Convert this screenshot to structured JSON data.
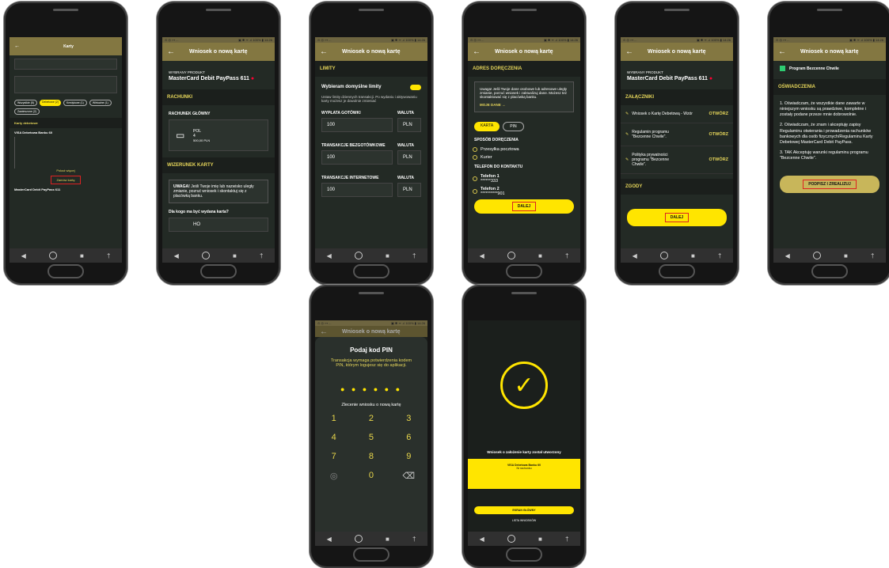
{
  "status": {
    "left": "⊙ ◎ ⊶ ...",
    "right": "▣ ✱ ᯤ .ıl 100% ▮ 14:26"
  },
  "p1": {
    "title": "Karty",
    "rows": [
      "Wszystkie (5)",
      "Debetowe (2)",
      "Kredytowe (1)",
      "Wirtualne (1)",
      "Zawieszone (2)"
    ],
    "section": "Karty debetowe",
    "card1": "VISA Debetowa Banku 60",
    "card2": "MasterCard Debit PayPass 611",
    "link": "Pokaż więcej",
    "btn": "Zamów kartę"
  },
  "p2": {
    "title": "Wniosek o nową kartę",
    "prodlbl": "WYBRANY PRODUKT",
    "prod": "MasterCard Debit PayPass 611",
    "sec1": "RACHUNKI",
    "acclbl": "RACHUNEK GŁÓWNY",
    "accname": "POL",
    "acc": "4",
    "bal": "500,00 PLN",
    "sec2": "WIZERUNEK KARTY",
    "warnb": "UWAGA!",
    "warn": " Jeśli Twoje imię lub nazwisko uległy zmianie, pozruć wniosek i skontaktuj się z placówką banku.",
    "q": "Dla kogo ma być wydana karta?",
    "who": "HO"
  },
  "p3": {
    "title": "Wniosek o nową kartę",
    "sec": "LIMITY",
    "def": "Wybieram domyślne limity",
    "info": "Ustaw limity dziennych transakcji. Po wydaniu i aktywowaniu karty możesz je dowolnie zmieniać",
    "l1": "WYPŁATA GOTÓWKI",
    "l2": "TRANSAKCJE BEZGOTÓWKOWE",
    "l3": "TRANSAKCJE INTERNETOWE",
    "wal": "WALUTA",
    "val": "100",
    "cur": "PLN"
  },
  "p4": {
    "title": "Wniosek o nową kartę",
    "sec": "ADRES DORĘCZENIA",
    "note": "Uwaga! Jeśli Twoje dane osobowe lub adresowe uległy zmianie, porzuć wniosek i zaktualizuj dane. Możesz też skontaktować się z placówką banku.",
    "myd": "MOJE DANE  →",
    "t1": "KARTA",
    "t2": "PIN",
    "del": "SPOSÓB DORĘCZENIA",
    "o1": "Przesyłka pocztowa",
    "o2": "Kurier",
    "tel": "TELEFON DO KONTAKTU",
    "tel1": "Telefon 1",
    "tel1n": "******333",
    "tel2": "Telefon 2",
    "tel2n": "**********901",
    "btn": "DALEJ"
  },
  "p5": {
    "title": "Wniosek o nową kartę",
    "prodlbl": "WYBRANY PRODUKT",
    "prod": "MasterCard Debit PayPass 611",
    "sec": "ZAŁĄCZNIKI",
    "a1": "Wniosek o Kartę Debetową - Wzór",
    "a2": "Regulamin programu \"Bezcenne Chwile\".",
    "a3": "Polityka prywatności programu \"Bezcenne Chwile\".",
    "open": "OTWÓRZ",
    "sec2": "ZGODY",
    "btn": "DALEJ"
  },
  "p6": {
    "title": "Wniosek o nową kartę",
    "chk": "Program Bezcenne Chwile",
    "sec": "OŚWIADCZENIA",
    "s1": "1. Oświadczam, że wszystkie dane zawarte w niniejszym wniosku są prawdziwe, kompletne i zostały podane przeze mnie dobrowolnie.",
    "s2": "2. Oświadczam, że znam i akceptuję zapisy Regulaminu otwierania i prowadzenia rachunków bankowych dla osób fizycznych/Regulaminu Karty Debetowej MasterCard Debit PayPass.",
    "s3": "3. TAK Akceptuję warunki regulaminu programu \"Bezcenne Chwile\".",
    "btn": "PODPISZ I ZREALIZUJ"
  },
  "p7": {
    "title": "Wniosek o nową kartę",
    "h": "Podaj kod PIN",
    "sub": "Transakcja wymaga potwierdzenia kodem PIN, którym logujesz się do aplikacji.",
    "act": "Zlecenie wniosku o nową kartę",
    "keys": [
      "1",
      "2",
      "3",
      "4",
      "5",
      "6",
      "7",
      "8",
      "9",
      "◎",
      "0",
      "⌫"
    ]
  },
  "p8": {
    "msg": "Wniosek o założenie karty został utworzony",
    "card": "VISA Debetowa Banku 60",
    "cnum": "Nr rachunku",
    "b1": "EKRAN GŁÓWNY",
    "b2": "LISTA WNIOSKÓW"
  }
}
